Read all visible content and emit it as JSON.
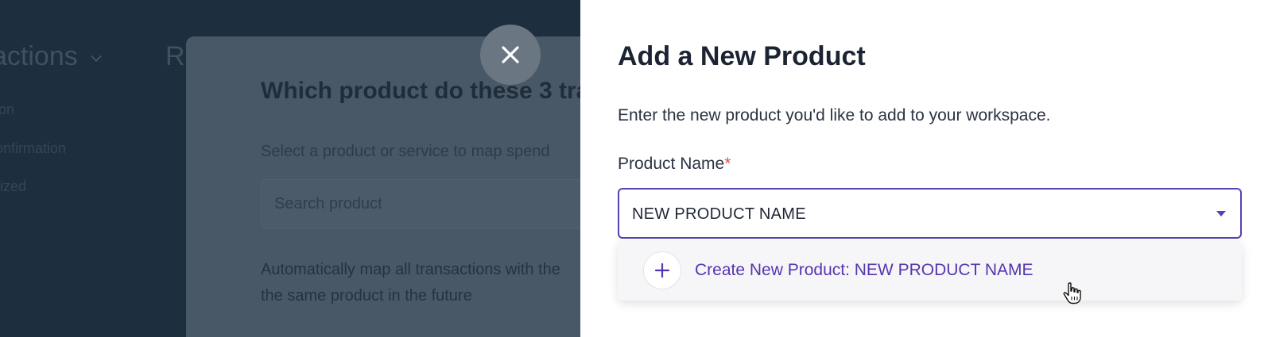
{
  "background": {
    "title_left": "actions",
    "title_right": "R",
    "nav_items": [
      "ion",
      "onfirmation",
      "rized"
    ]
  },
  "bg_modal": {
    "title": "Which product do these 3 tra",
    "subtitle": "Select a product or service to map spend",
    "search_placeholder": "Search product",
    "auto_map_line1": "Automatically map all transactions with the",
    "auto_map_line2": "the same product in the future"
  },
  "panel": {
    "title": "Add a New Product",
    "description": "Enter the new product you'd like to add to your workspace.",
    "field_label": "Product Name",
    "required_mark": "*",
    "field_value": "NEW PRODUCT NAME",
    "create_option": "Create New Product: NEW PRODUCT NAME"
  },
  "icons": {
    "close": "close-icon",
    "caret": "caret-down-icon",
    "plus": "plus-icon",
    "cursor": "hand-pointer-icon"
  },
  "colors": {
    "accent": "#5b3fb6",
    "required": "#d9534f"
  }
}
